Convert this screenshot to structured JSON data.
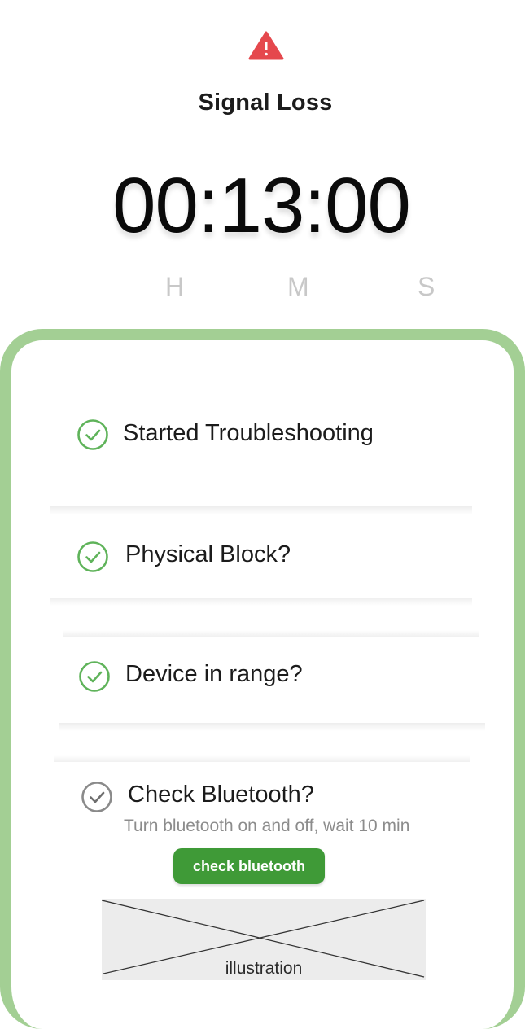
{
  "alert": {
    "icon": "warning-triangle-icon",
    "title": "Signal Loss"
  },
  "timer": {
    "display": "00:13:00",
    "units": {
      "h": "H",
      "m": "M",
      "s": "S"
    }
  },
  "steps": [
    {
      "label": "Started Troubleshooting",
      "status": "done",
      "icon": "check-circle-icon"
    },
    {
      "label": "Physical Block?",
      "status": "done",
      "icon": "check-circle-icon"
    },
    {
      "label": "Device in range?",
      "status": "done",
      "icon": "check-circle-icon"
    },
    {
      "label": "Check Bluetooth?",
      "status": "current",
      "icon": "check-circle-icon",
      "hint": "Turn bluetooth on and off, wait 10 min",
      "action_label": "check bluetooth",
      "illustration_label": "illustration"
    }
  ],
  "colors": {
    "accent": "#3f9a37",
    "panel_border": "#a3cf94",
    "warning": "#e5484d",
    "done_check": "#5fb35a",
    "current_check": "#8a8a8a"
  }
}
